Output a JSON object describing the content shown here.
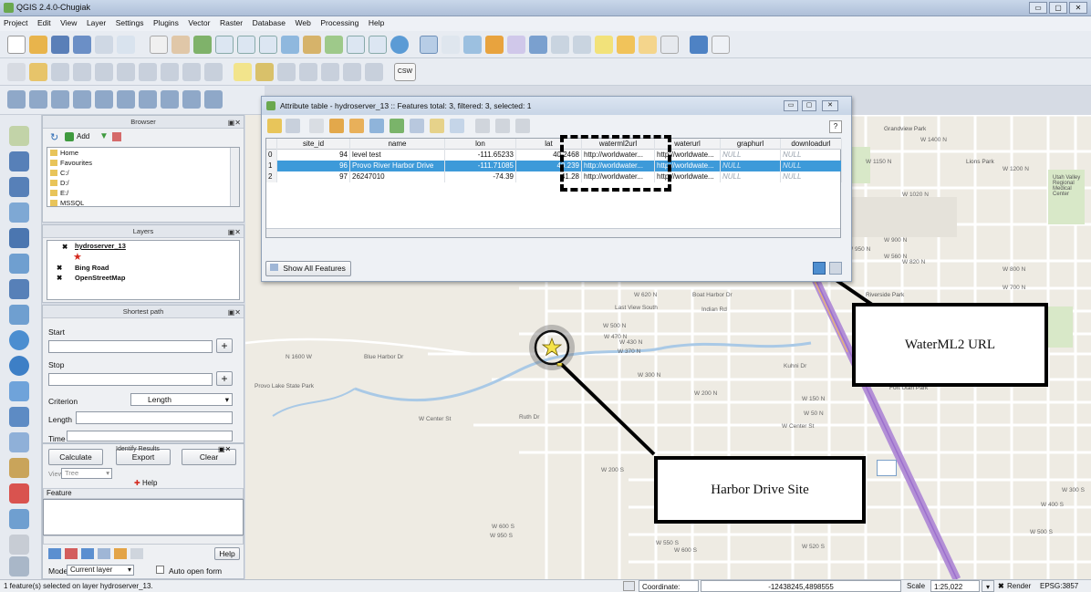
{
  "window": {
    "title": "QGIS 2.4.0-Chugiak",
    "btn_min": "▭",
    "btn_max": "▢",
    "btn_close": "✕"
  },
  "menu": [
    "Project",
    "Edit",
    "View",
    "Layer",
    "Settings",
    "Plugins",
    "Vector",
    "Raster",
    "Database",
    "Web",
    "Processing",
    "Help"
  ],
  "toolbar": {
    "csw_label": "CSW"
  },
  "browser": {
    "title": "Browser",
    "add_label": "Add",
    "items": [
      "Home",
      "Favourites",
      "C:/",
      "D:/",
      "E:/",
      "MSSQL"
    ]
  },
  "layers": {
    "title": "Layers",
    "items": [
      "hydroserver_13",
      "Bing Road",
      "OpenStreetMap"
    ]
  },
  "shortest_path": {
    "title": "Shortest path",
    "start_label": "Start",
    "stop_label": "Stop",
    "criterion_label": "Criterion",
    "criterion_value": "Length",
    "length_label": "Length",
    "time_label": "Time",
    "calculate_label": "Calculate",
    "export_label": "Export",
    "clear_label": "Clear",
    "help_label": "Help"
  },
  "identify": {
    "title": "Identify Results",
    "view_label": "View",
    "view_value": "Tree",
    "feature_header": "Feature",
    "help_label": "Help",
    "mode_label": "Mode",
    "mode_value": "Current layer",
    "auto_open_label": "Auto open form"
  },
  "attribute_table": {
    "title": "Attribute table - hydroserver_13 :: Features total: 3, filtered: 3, selected: 1",
    "columns": [
      "site_id",
      "name",
      "lon",
      "lat",
      "waterml2url",
      "waterurl",
      "graphurl",
      "downloadurl"
    ],
    "rows": [
      {
        "index": "0",
        "site_id": "94",
        "name": "level test",
        "lon": "-111.65233",
        "lat": "40.2468",
        "waterml2url": "http://worldwater...",
        "waterurl": "http://worldwate...",
        "graphurl": "NULL",
        "downloadurl": "NULL"
      },
      {
        "index": "1",
        "site_id": "96",
        "name": "Provo River Harbor Drive",
        "lon": "-111.71085",
        "lat": "40.239",
        "waterml2url": "http://worldwater...",
        "waterurl": "http://worldwate...",
        "graphurl": "NULL",
        "downloadurl": "NULL"
      },
      {
        "index": "2",
        "site_id": "97",
        "name": "26247010",
        "lon": "-74.39",
        "lat": "41.28",
        "waterml2url": "http://worldwater...",
        "waterurl": "http://worldwate...",
        "graphurl": "NULL",
        "downloadurl": "NULL"
      }
    ],
    "show_all_label": "Show All Features",
    "help_icon": "?"
  },
  "map": {
    "labels": [
      "Blue Harbor Dr",
      "Last View South",
      "Boat Harbor Dr",
      "W Center St",
      "W 600 S",
      "W 620 N",
      "W 500 N",
      "W 470 N",
      "W 430 N",
      "W 370 N",
      "W 300 N",
      "W 200 N",
      "W 150 N",
      "W 50 N",
      "W Center St",
      "W 950 S",
      "W 550 S",
      "W 600 S",
      "W 520 S",
      "W 300 S",
      "W 400 S",
      "W 500 S",
      "Riverside Park",
      "Fort Utah Park",
      "Utah Valley Regional Medical Center",
      "Grandview Park",
      "Lions Park",
      "W 1400 N",
      "W 1200 N",
      "W 800 N",
      "W 900 N",
      "W 700 N",
      "W 1150 N",
      "W 1020 N",
      "W 950 N",
      "W 560 N",
      "W 820 N",
      "Provo Lake State Park",
      "W 200 S",
      "Kuhni Dr",
      "Ruth Dr",
      "Indian Rd",
      "N 1600 W"
    ]
  },
  "callouts": {
    "waterml2": "WaterML2 URL",
    "harbor": "Harbor Drive Site"
  },
  "status": {
    "message": "1 feature(s) selected on layer hydroserver_13.",
    "coordinate_label": "Coordinate:",
    "coordinate_value": "-12438245,4898555",
    "scale_label": "Scale",
    "scale_value": "1:25,022",
    "render_label": "Render",
    "crs_label": "EPSG:3857"
  },
  "colors": {
    "selection": "#3d9ad9",
    "freeway": "#b38fd6",
    "river": "#a9c9e6",
    "callout_border": "#000000"
  }
}
